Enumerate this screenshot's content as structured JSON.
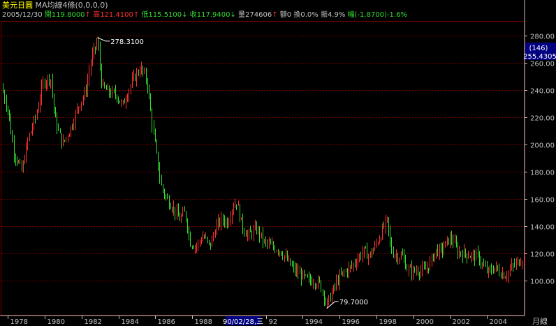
{
  "header": {
    "title": "美元日圓",
    "ma_label": "MA均線4條(0,0,0,0)",
    "date": "2005/12/30",
    "open_label": "開",
    "open": "119.8000",
    "high_label": "高",
    "high": "121.4100",
    "low_label": "低",
    "low": "115.5100",
    "close_label": "收",
    "close": "117.9400",
    "volume_label": "量",
    "volume": "274606",
    "amount_label": "額",
    "amount": "0",
    "turnover_label": "換",
    "turnover": "0.0%",
    "amplitude_label": "振",
    "amplitude": "4.9%",
    "change_label": "幅",
    "change": "(-1.8700)",
    "change_pct": "-1.6%",
    "arrow_up": "↑",
    "arrow_down": "↓"
  },
  "price_box": {
    "count": "(146)",
    "price": "255.4305"
  },
  "cursor_date": "90/02/28,三",
  "period_label": "月線",
  "annotations": {
    "max": "278.3100",
    "min": "79.7000"
  },
  "colors": {
    "up": "#ff3030",
    "down": "#33dd33",
    "grid": "#7a0000",
    "axis_text": "#c0c0c0",
    "price_box_bg": "#000080"
  },
  "chart_data": {
    "type": "candlestick",
    "ylim": [
      75,
      290
    ],
    "xlim": [
      1977.65,
      2006.0
    ],
    "y_ticks": [
      100,
      120,
      140,
      160,
      180,
      200,
      220,
      240,
      260,
      280
    ],
    "y_tick_labels": [
      "100.00",
      "120.00",
      "140.00",
      "160.00",
      "180.00",
      "200.00",
      "220.00",
      "240.00",
      "260.00",
      "280.00"
    ],
    "x_ticks": [
      1978,
      1980,
      1982,
      1984,
      1986,
      1988,
      1992,
      1994,
      1996,
      1998,
      2000,
      2002,
      2004
    ],
    "x_tick_labels": [
      "1978",
      "1980",
      "1982",
      "1984",
      "1986",
      "1988",
      "92",
      "1994",
      "1996",
      "1998",
      "2000",
      "2002",
      "2004"
    ],
    "max_point": {
      "x": 1982.85,
      "y": 278.31
    },
    "min_point": {
      "x": 1995.3,
      "y": 79.7
    },
    "path": [
      [
        1977.65,
        242
      ],
      [
        1978.0,
        225
      ],
      [
        1978.3,
        195
      ],
      [
        1978.75,
        180
      ],
      [
        1979.1,
        205
      ],
      [
        1979.5,
        220
      ],
      [
        1979.9,
        245
      ],
      [
        1980.3,
        250
      ],
      [
        1980.55,
        218
      ],
      [
        1980.95,
        200
      ],
      [
        1981.4,
        212
      ],
      [
        1981.8,
        228
      ],
      [
        1982.2,
        238
      ],
      [
        1982.5,
        262
      ],
      [
        1982.85,
        276
      ],
      [
        1983.1,
        242
      ],
      [
        1983.5,
        238
      ],
      [
        1983.9,
        236
      ],
      [
        1984.2,
        228
      ],
      [
        1984.6,
        242
      ],
      [
        1984.9,
        250
      ],
      [
        1985.2,
        256
      ],
      [
        1985.55,
        246
      ],
      [
        1985.75,
        222
      ],
      [
        1986.0,
        198
      ],
      [
        1986.3,
        170
      ],
      [
        1986.6,
        160
      ],
      [
        1986.9,
        155
      ],
      [
        1987.3,
        145
      ],
      [
        1987.6,
        150
      ],
      [
        1987.9,
        128
      ],
      [
        1988.2,
        125
      ],
      [
        1988.6,
        133
      ],
      [
        1988.95,
        125
      ],
      [
        1989.3,
        140
      ],
      [
        1989.6,
        145
      ],
      [
        1989.9,
        143
      ],
      [
        1990.2,
        155
      ],
      [
        1990.4,
        158
      ],
      [
        1990.7,
        140
      ],
      [
        1991.0,
        133
      ],
      [
        1991.5,
        138
      ],
      [
        1991.9,
        128
      ],
      [
        1992.3,
        125
      ],
      [
        1992.7,
        123
      ],
      [
        1993.0,
        118
      ],
      [
        1993.5,
        108
      ],
      [
        1993.9,
        104
      ],
      [
        1994.3,
        100
      ],
      [
        1994.6,
        100
      ],
      [
        1994.9,
        98
      ],
      [
        1995.2,
        88
      ],
      [
        1995.3,
        83
      ],
      [
        1995.55,
        90
      ],
      [
        1995.85,
        100
      ],
      [
        1996.2,
        106
      ],
      [
        1996.6,
        110
      ],
      [
        1996.9,
        115
      ],
      [
        1997.3,
        122
      ],
      [
        1997.6,
        118
      ],
      [
        1997.9,
        125
      ],
      [
        1998.3,
        136
      ],
      [
        1998.55,
        145
      ],
      [
        1998.8,
        122
      ],
      [
        1999.1,
        118
      ],
      [
        1999.4,
        118
      ],
      [
        1999.7,
        108
      ],
      [
        2000.0,
        107
      ],
      [
        2000.3,
        108
      ],
      [
        2000.6,
        107
      ],
      [
        2000.9,
        113
      ],
      [
        2001.2,
        122
      ],
      [
        2001.5,
        122
      ],
      [
        2001.9,
        130
      ],
      [
        2002.1,
        131
      ],
      [
        2002.4,
        121
      ],
      [
        2002.8,
        120
      ],
      [
        2003.2,
        118
      ],
      [
        2003.5,
        118
      ],
      [
        2003.8,
        110
      ],
      [
        2004.1,
        106
      ],
      [
        2004.4,
        110
      ],
      [
        2004.7,
        106
      ],
      [
        2005.0,
        104
      ],
      [
        2005.35,
        110
      ],
      [
        2005.7,
        114
      ],
      [
        2006.0,
        118
      ]
    ]
  }
}
